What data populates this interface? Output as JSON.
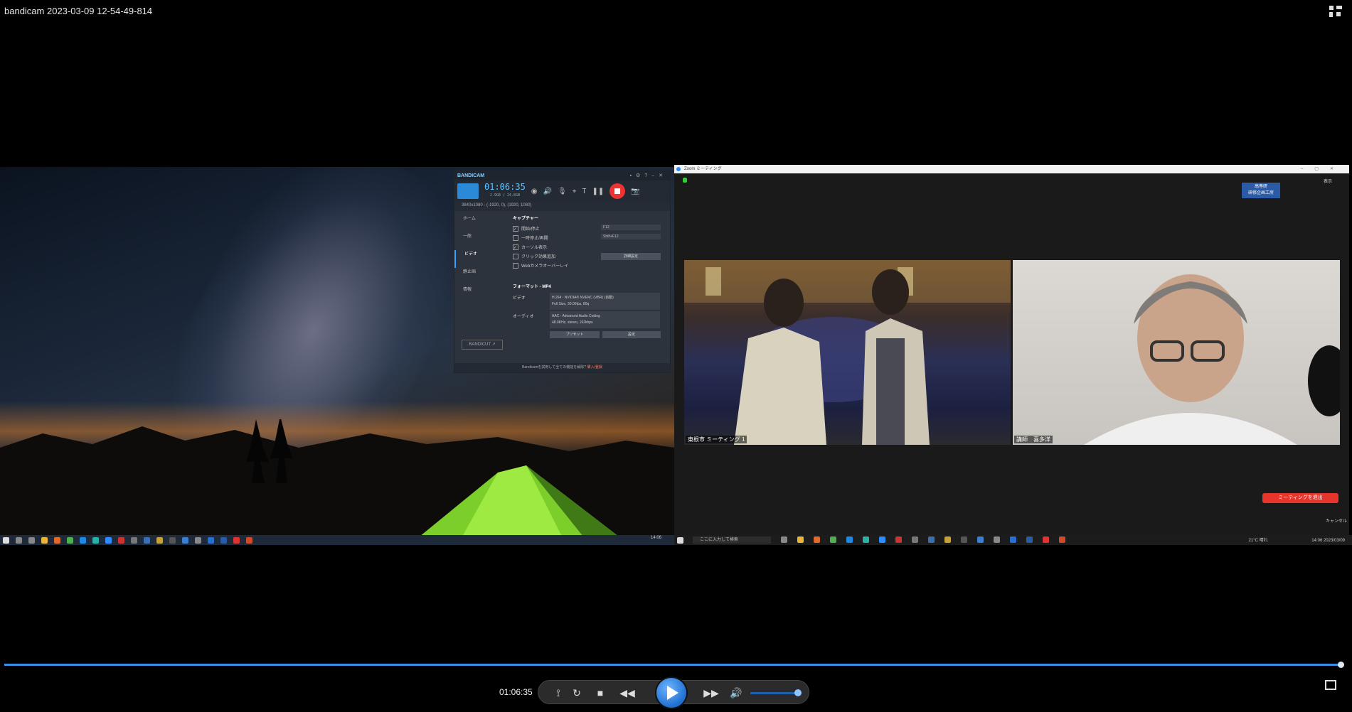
{
  "window": {
    "title": "bandicam 2023-03-09 12-54-49-814",
    "fullscreen_icon": "exit-fullscreen-icon"
  },
  "bandicam": {
    "logo": "BANDICAM",
    "timer": "01:06:35",
    "size": "2.9GB / 24.8GB",
    "mode": "3840x1080 - (-1920, 0), (1920, 1080)",
    "sidebar": [
      "ホーム",
      "一般",
      "ビデオ",
      "静止画",
      "情報"
    ],
    "capture_heading": "キャプチャー",
    "capture_rows": [
      {
        "label": "開始/停止",
        "checked": true,
        "value": "F12"
      },
      {
        "label": "一時停止/再開",
        "checked": false,
        "value": "Shift+F12"
      },
      {
        "label": "カーソル表示",
        "checked": true,
        "value": ""
      },
      {
        "label": "クリック効果追加",
        "checked": false,
        "value": ""
      },
      {
        "label": "Webカメラオーバーレイ",
        "checked": false,
        "value": ""
      }
    ],
    "advanced_button": "詳細設定",
    "format_heading": "フォーマット - MP4",
    "video_label": "ビデオ",
    "video_line1": "H.264 - NVIDIA® NVENC (VBR) (自動)",
    "video_line2": "Full Size, 30.00fps, 80q",
    "audio_label": "オーディオ",
    "audio_line1": "AAC - Advanced Audio Coding",
    "audio_line2": "48.0KHz, stereo, 192kbps",
    "preset_button": "プリセット",
    "settings_button": "設定",
    "bandicut": "BANDICUT ↗",
    "footer": "Bandicamを試用して全ての機能を解除?",
    "footer_link": "購入/登録"
  },
  "zoom": {
    "window_title": "Zoom ミーティング",
    "view_label": "表示",
    "badge": "高専研\n研修企画工房",
    "tile1_label": "東根市 ミーティング 1",
    "tile2_label": "講師　喜多洋",
    "leave_button": "ミーティングを退出",
    "cancel": "キャンセル"
  },
  "right_taskbar": {
    "search_placeholder": "ここに入力して検索",
    "weather": "21°C 晴れ",
    "clock": "14:06\n2023/03/09"
  },
  "left_taskbar": {
    "clock": "14:06"
  },
  "player": {
    "timecode": "01:06:35",
    "progress": 0.997,
    "volume": 0.9,
    "accent": "#3a8ee6"
  }
}
